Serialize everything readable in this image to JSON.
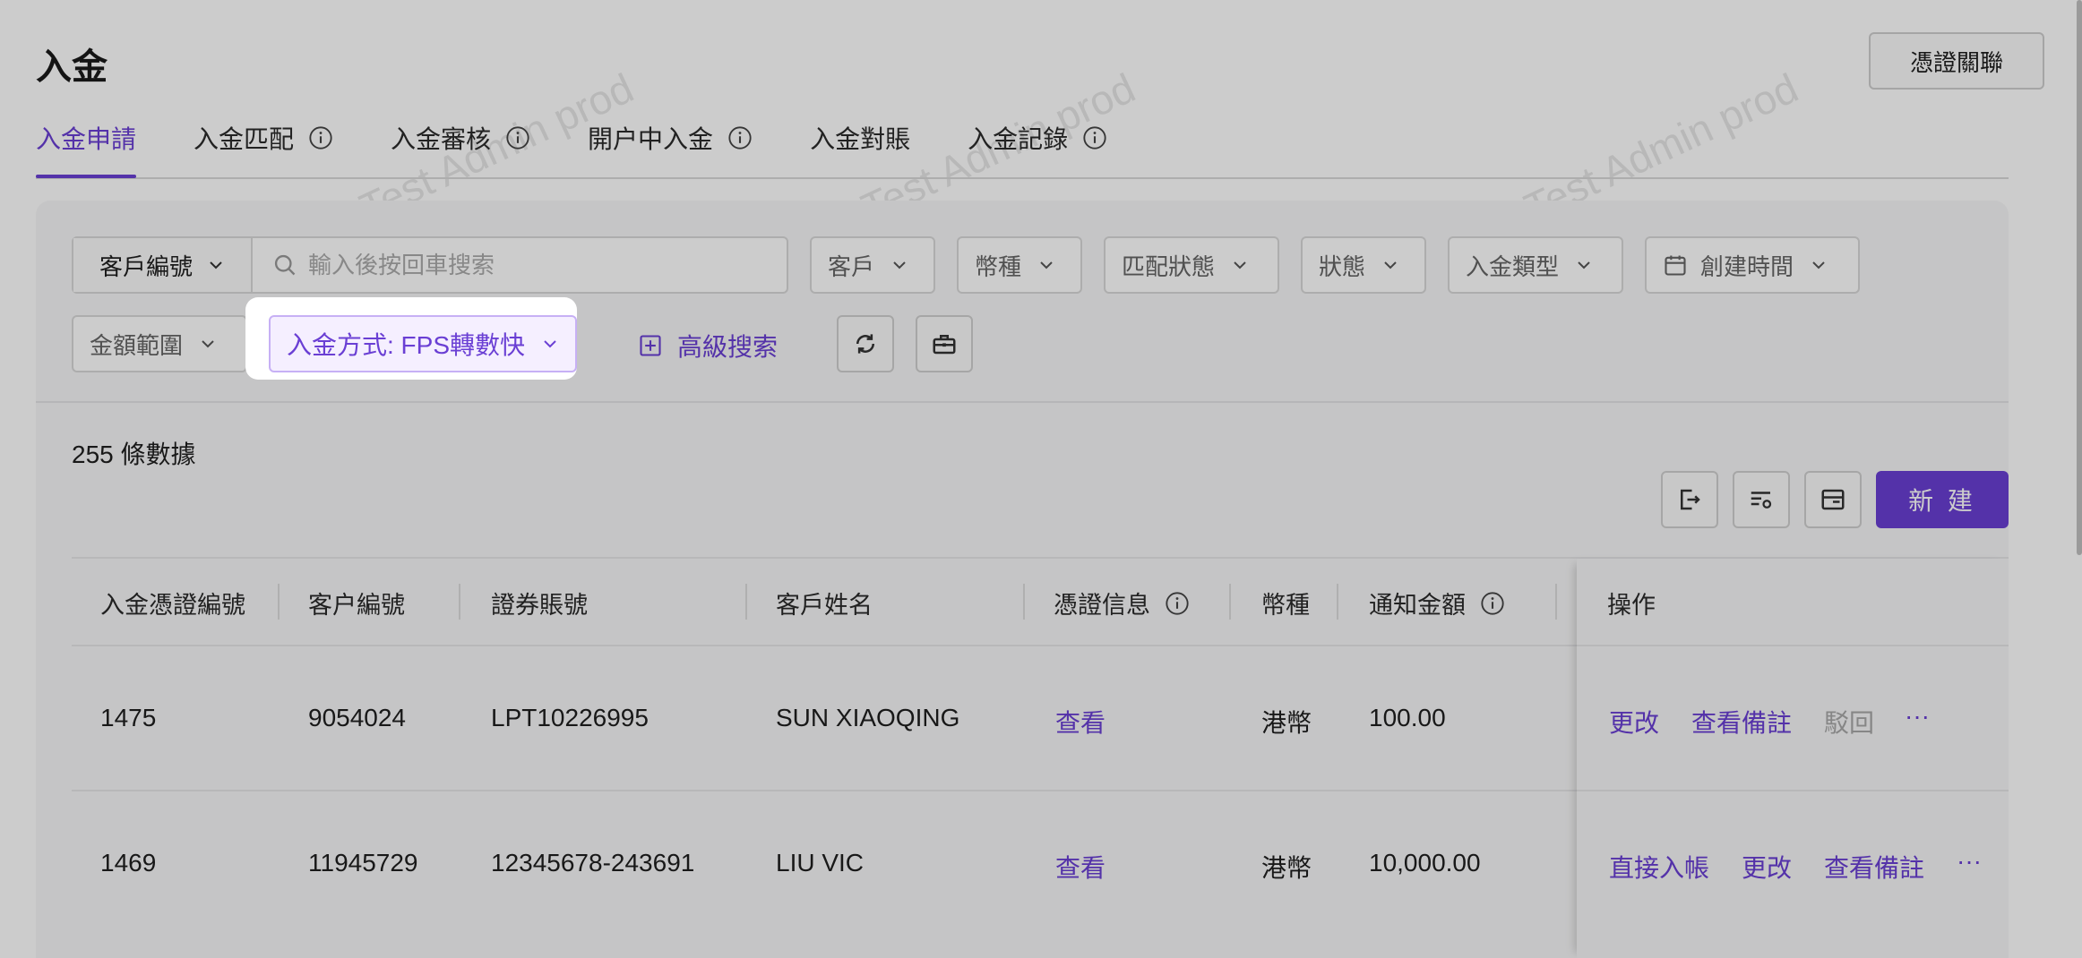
{
  "header": {
    "title": "入金",
    "link_button": "憑證關聯"
  },
  "tabs": [
    {
      "label": "入金申請",
      "active": true,
      "info": false
    },
    {
      "label": "入金匹配",
      "active": false,
      "info": true
    },
    {
      "label": "入金審核",
      "active": false,
      "info": true
    },
    {
      "label": "開户中入金",
      "active": false,
      "info": true
    },
    {
      "label": "入金對賬",
      "active": false,
      "info": false
    },
    {
      "label": "入金記錄",
      "active": false,
      "info": true
    }
  ],
  "filters": {
    "search_type": "客戶編號",
    "search_placeholder": "輸入後按回車搜索",
    "customer": "客戶",
    "currency": "幣種",
    "match_status": "匹配狀態",
    "status": "狀態",
    "deposit_type": "入金類型",
    "created_time": "創建時間",
    "amount_range": "金額範圍",
    "deposit_method": "入金方式: FPS轉數快",
    "advanced_search": "高級搜索"
  },
  "summary": {
    "count_text": "255 條數據"
  },
  "toolbar": {
    "new_label": "新 建"
  },
  "table": {
    "headers": [
      "入金憑證編號",
      "客户編號",
      "證券賬號",
      "客戶姓名",
      "憑證信息",
      "幣種",
      "通知金額",
      "操作"
    ],
    "rows": [
      {
        "voucher_no": "1475",
        "customer_no": "9054024",
        "account": "LPT10226995",
        "name": "SUN XIAOQING",
        "voucher_info": "查看",
        "currency": "港幣",
        "amount": "100.00",
        "actions": [
          "更改",
          "查看備註",
          "駁回",
          "···"
        ]
      },
      {
        "voucher_no": "1469",
        "customer_no": "11945729",
        "account": "12345678-243691",
        "name": "LIU VIC",
        "voucher_info": "查看",
        "currency": "港幣",
        "amount": "10,000.00",
        "actions": [
          "直接入帳",
          "更改",
          "查看備註",
          "···"
        ]
      }
    ]
  },
  "watermark": "LongPort Test Admin prod",
  "colors": {
    "accent": "#6a3fd4",
    "overlay": "rgba(0,0,0,0.2)"
  }
}
